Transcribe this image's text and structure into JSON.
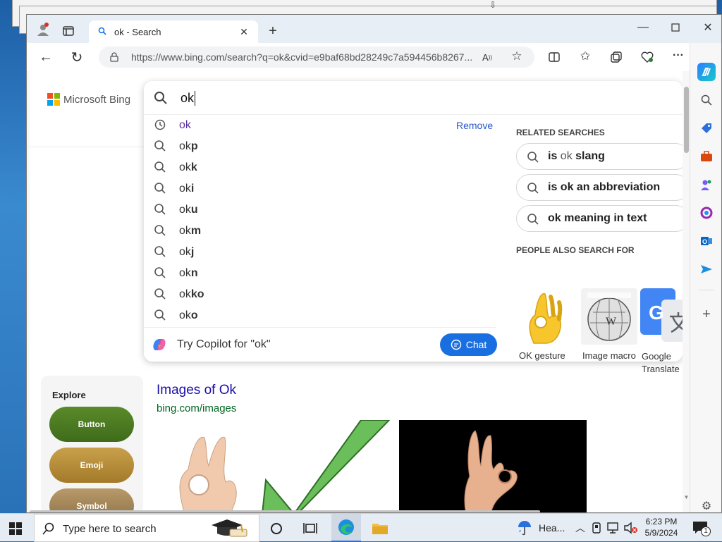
{
  "browser": {
    "tab_title": "ok - Search",
    "url": "https://www.bing.com/search?q=ok&cvid=e9baf68bd28249c7a594456b8267..."
  },
  "bing": {
    "logo_text": "Microsoft Bing",
    "query": "ok",
    "suggestions": [
      {
        "base": "ok",
        "bold": ""
      },
      {
        "base": "ok",
        "bold": "p"
      },
      {
        "base": "ok",
        "bold": "k"
      },
      {
        "base": "ok",
        "bold": "i"
      },
      {
        "base": "ok",
        "bold": "u"
      },
      {
        "base": "ok",
        "bold": "m"
      },
      {
        "base": "ok",
        "bold": "j"
      },
      {
        "base": "ok",
        "bold": "n"
      },
      {
        "base": "ok",
        "bold": "ko"
      },
      {
        "base": "ok",
        "bold": "o"
      }
    ],
    "remove_label": "Remove",
    "copilot_text": "Try Copilot for \"ok\"",
    "chat_label": "Chat",
    "related_heading": "RELATED SEARCHES",
    "related": [
      {
        "pre": "is",
        "mid": " ok ",
        "post": "slang"
      },
      {
        "pre": "is ok an abbreviation",
        "mid": "",
        "post": ""
      },
      {
        "pre": "ok meaning in text",
        "mid": "",
        "post": ""
      }
    ],
    "pasf_heading": "PEOPLE ALSO SEARCH FOR",
    "pasf": [
      {
        "label": "OK gesture"
      },
      {
        "label": "Image macro"
      },
      {
        "label": "Google Translate"
      }
    ],
    "explore_heading": "Explore",
    "explore": [
      "Button",
      "Emoji",
      "Symbol"
    ],
    "images_title": "Images of Ok",
    "images_url": "bing.com/images"
  },
  "taskbar": {
    "search_placeholder": "Type here to search",
    "weather": "Hea...",
    "time": "6:23 PM",
    "date": "5/9/2024",
    "notification_count": "1"
  }
}
